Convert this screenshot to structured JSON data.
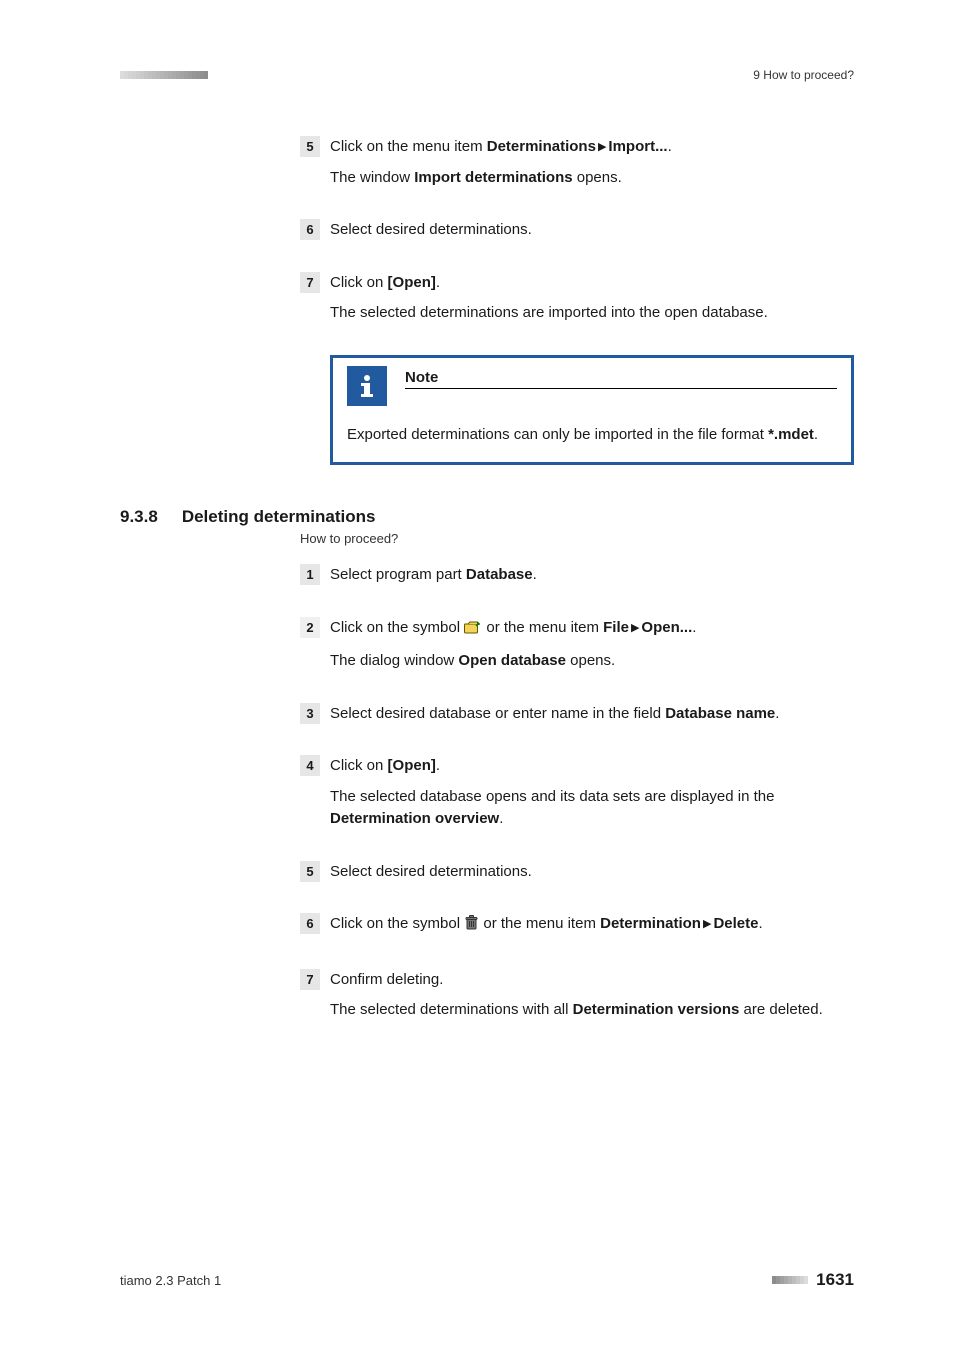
{
  "header": {
    "right": "9 How to proceed?"
  },
  "stepsA": [
    {
      "num": "5",
      "text_parts": [
        "Click on the menu item ",
        "Determinations",
        " ▸ ",
        "Import...",
        "."
      ],
      "textSub": "The window ",
      "textSubBold": "Import determinations",
      "textSubAfter": " opens."
    },
    {
      "num": "6",
      "text_parts": [
        "Select desired determinations."
      ]
    },
    {
      "num": "7",
      "text_parts": [
        "Click on ",
        "[Open]",
        "."
      ],
      "textSub": "The selected determinations are imported into the open database."
    }
  ],
  "note": {
    "title": "Note",
    "body_pre": "Exported determinations can only be imported in the file format ",
    "body_bold": "*.mdet",
    "body_post": "."
  },
  "section": {
    "num": "9.3.8",
    "title": "Deleting determinations",
    "sub": "How to proceed?"
  },
  "stepsB": [
    {
      "num": "1",
      "text_parts": [
        "Select program part ",
        "Database",
        "."
      ]
    },
    {
      "num": "2",
      "icon": "folder",
      "text_pre": "Click on the symbol ",
      "text_post_parts": [
        " or the menu item ",
        "File",
        " ▸ ",
        "Open...",
        "."
      ],
      "textSub": "The dialog window ",
      "textSubBold": "Open database",
      "textSubAfter": " opens."
    },
    {
      "num": "3",
      "text_parts": [
        "Select desired database or enter name in the field ",
        "Database name",
        "."
      ]
    },
    {
      "num": "4",
      "text_parts": [
        "Click on ",
        "[Open]",
        "."
      ],
      "textSub": "The selected database opens and its data sets are displayed in the ",
      "textSubBold": "Determination overview",
      "textSubAfter": "."
    },
    {
      "num": "5",
      "text_parts": [
        "Select desired determinations."
      ]
    },
    {
      "num": "6",
      "icon": "trash",
      "text_pre": "Click on the symbol ",
      "text_post_parts": [
        " or the menu item ",
        "Determination",
        " ▸ ",
        "Delete",
        "."
      ]
    },
    {
      "num": "7",
      "text_parts": [
        "Confirm deleting."
      ],
      "textSub_parts": [
        "The selected determinations with all ",
        "Determination versions",
        " are deleted."
      ]
    }
  ],
  "footer": {
    "left": "tiamo 2.3 Patch 1",
    "pageNum": "1631"
  },
  "colors": {
    "tick_dark": "#8d8d8d",
    "tick_light": "#bcbcbc"
  }
}
